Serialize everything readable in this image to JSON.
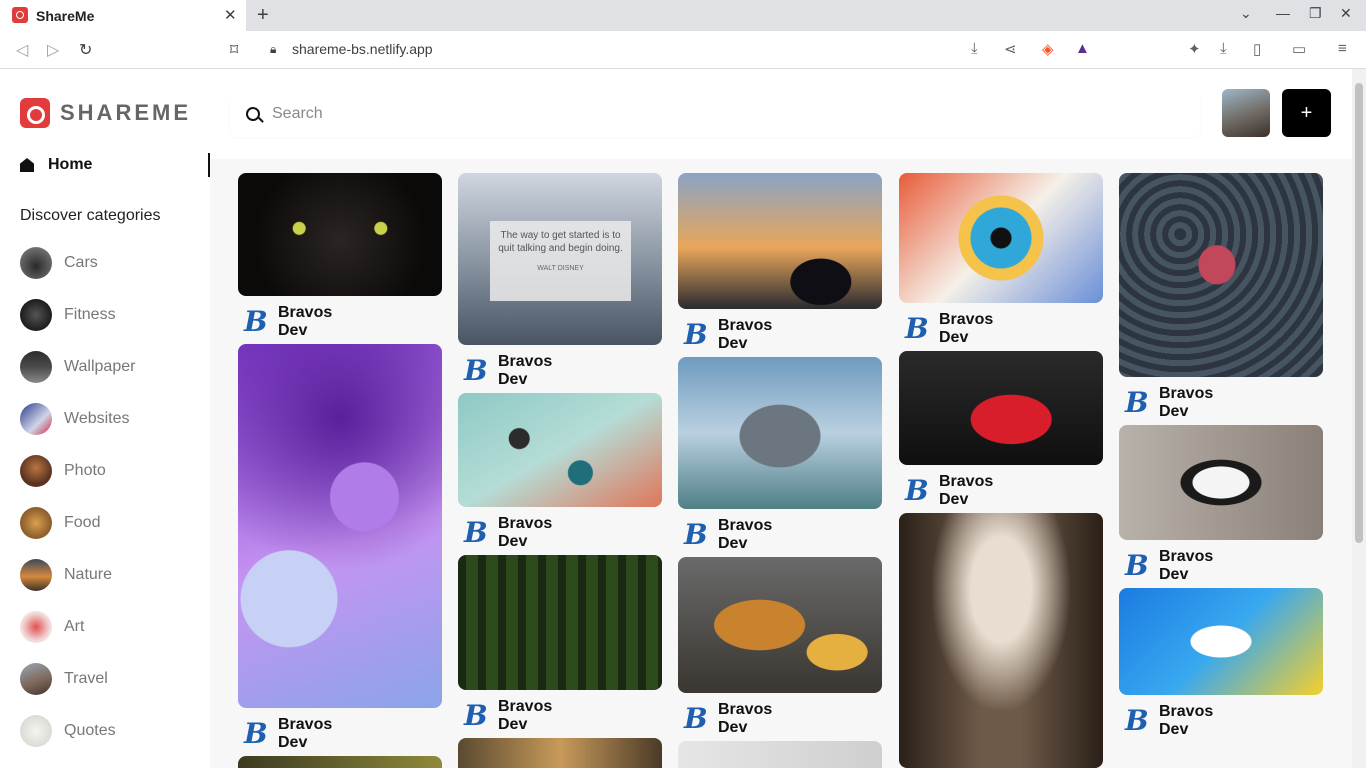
{
  "browser": {
    "tab_title": "ShareMe",
    "url": "shareme-bs.netlify.app"
  },
  "sidebar": {
    "logo_text": "SHAREME",
    "home_label": "Home",
    "discover_label": "Discover categories",
    "categories": [
      {
        "label": "Cars"
      },
      {
        "label": "Fitness"
      },
      {
        "label": "Wallpaper"
      },
      {
        "label": "Websites"
      },
      {
        "label": "Photo"
      },
      {
        "label": "Food"
      },
      {
        "label": "Nature"
      },
      {
        "label": "Art"
      },
      {
        "label": "Travel"
      },
      {
        "label": "Quotes"
      }
    ]
  },
  "header": {
    "search_placeholder": "Search",
    "add_label": "+"
  },
  "pins": [
    {
      "author": "Bravos Dev",
      "subject": "cat"
    },
    {
      "author": "Bravos Dev",
      "subject": "purple-bubbles"
    },
    {
      "author": "Bravos Dev",
      "subject": "quote-icicles"
    },
    {
      "author": "Bravos Dev",
      "subject": "dumbbells"
    },
    {
      "author": "Bravos Dev",
      "subject": "forest"
    },
    {
      "author": "Bravos Dev",
      "subject": "airport"
    },
    {
      "author": "Bravos Dev",
      "subject": "concept-car"
    },
    {
      "author": "Bravos Dev",
      "subject": "burger"
    },
    {
      "author": "Bravos Dev",
      "subject": "eye-art"
    },
    {
      "author": "Bravos Dev",
      "subject": "red-corvette"
    },
    {
      "author": "Bravos Dev",
      "subject": "misty-forest-road"
    },
    {
      "author": "Bravos Dev",
      "subject": "butterfly-leaves"
    },
    {
      "author": "Bravos Dev",
      "subject": "cat-couch"
    },
    {
      "author": "Bravos Dev",
      "subject": "website-illustration"
    }
  ],
  "quote_card": {
    "text": "The way to get started is to quit talking and begin doing.",
    "attribution": "WALT DISNEY"
  }
}
